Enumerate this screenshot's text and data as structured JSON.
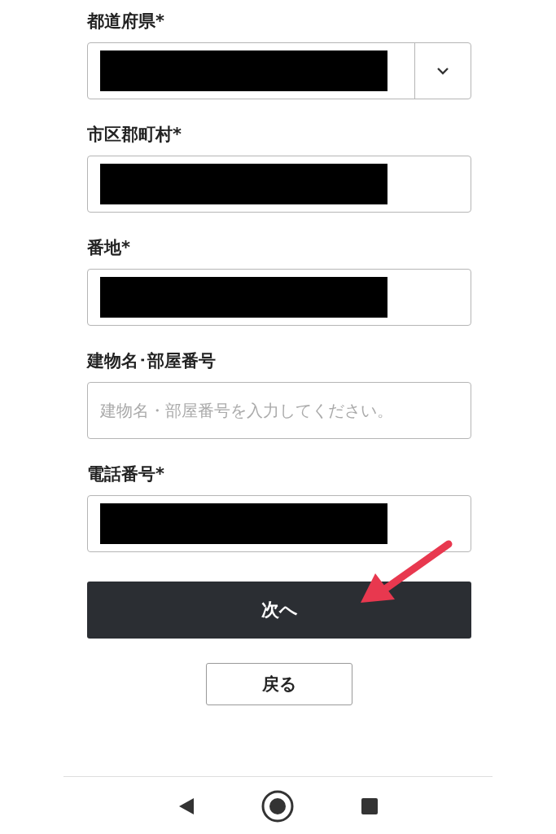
{
  "fields": [
    {
      "label": "都道府県*",
      "kind": "select",
      "redacted": true
    },
    {
      "label": "市区郡町村*",
      "kind": "text",
      "redacted": true
    },
    {
      "label": "番地*",
      "kind": "text",
      "redacted": true
    },
    {
      "label": "建物名･部屋番号",
      "kind": "text",
      "redacted": false,
      "placeholder": "建物名・部屋番号を入力してください。"
    },
    {
      "label": "電話番号*",
      "kind": "text",
      "redacted": true
    }
  ],
  "next_button": "次へ",
  "back_button": "戻る"
}
